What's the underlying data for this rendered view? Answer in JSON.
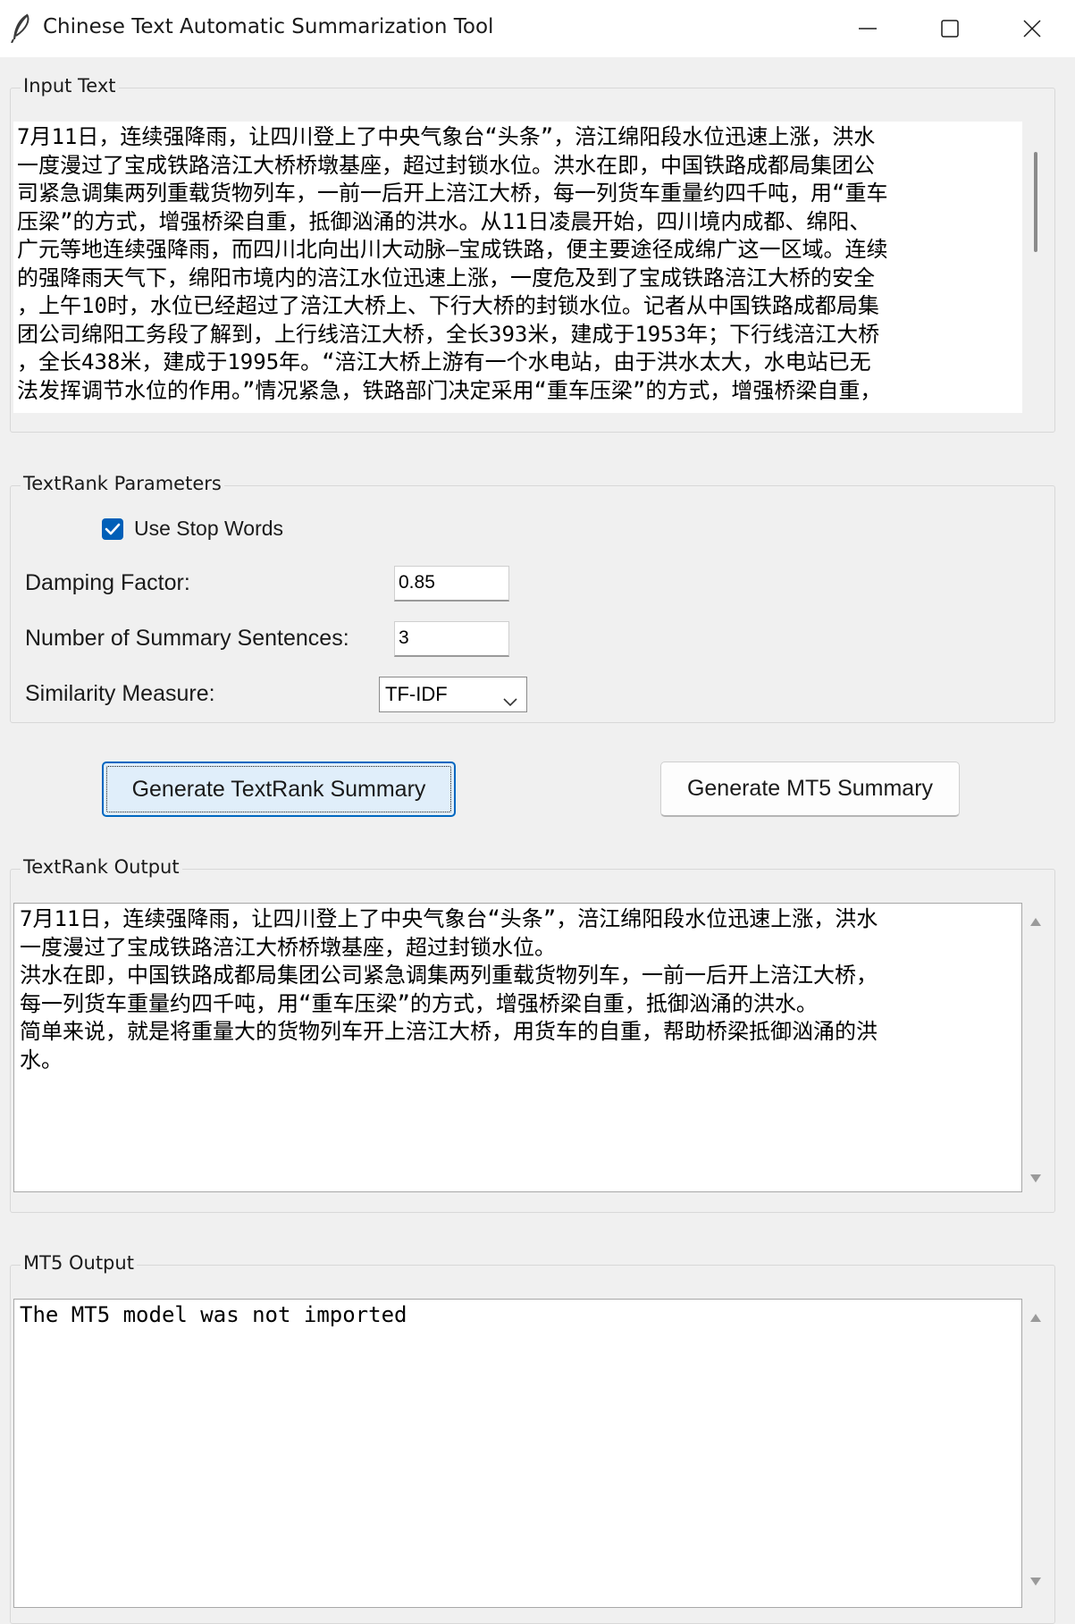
{
  "window": {
    "title": "Chinese Text Automatic Summarization Tool",
    "icons": {
      "app": "feather-icon",
      "minimize": "minimize-icon",
      "maximize": "maximize-icon",
      "close": "close-icon"
    }
  },
  "input_section": {
    "label": "Input Text",
    "lines": [
      "7月11日，连续强降雨，让四川登上了中央气象台“头条”，涪江绵阳段水位迅速上涨，洪水",
      "一度漫过了宝成铁路涪江大桥桥墩基座，超过封锁水位。洪水在即，中国铁路成都局集团公",
      "司紧急调集两列重载货物列车，一前一后开上涪江大桥，每一列货车重量约四千吨，用“重车",
      "压梁”的方式，增强桥梁自重，抵御汹涌的洪水。从11日凌晨开始，四川境内成都、绵阳、",
      "广元等地连续强降雨，而四川北向出川大动脉—宝成铁路，便主要途径成绵广这一区域。连续",
      "的强降雨天气下，绵阳市境内的涪江水位迅速上涨，一度危及到了宝成铁路涪江大桥的安全",
      "，上午10时，水位已经超过了涪江大桥上、下行大桥的封锁水位。记者从中国铁路成都局集",
      "团公司绵阳工务段了解到，上行线涪江大桥，全长393米，建成于1953年；下行线涪江大桥",
      "，全长438米，建成于1995年。“涪江大桥上游有一个水电站，由于洪水太大，水电站已无",
      "法发挥调节水位的作用。”情况紧急，铁路部门决定采用“重车压梁”的方式，增强桥梁自重，"
    ]
  },
  "params": {
    "label": "TextRank Parameters",
    "use_stop_words": {
      "label": "Use Stop Words",
      "checked": true
    },
    "damping": {
      "label": "Damping Factor:",
      "value": "0.85"
    },
    "num_sentences": {
      "label": "Number of Summary Sentences:",
      "value": "3"
    },
    "similarity": {
      "label": "Similarity Measure:",
      "value": "TF-IDF"
    }
  },
  "buttons": {
    "textrank": "Generate TextRank Summary",
    "mt5": "Generate MT5 Summary"
  },
  "textrank_output": {
    "label": "TextRank Output",
    "lines": [
      "7月11日，连续强降雨，让四川登上了中央气象台“头条”，涪江绵阳段水位迅速上涨，洪水",
      "一度漫过了宝成铁路涪江大桥桥墩基座，超过封锁水位。",
      "洪水在即，中国铁路成都局集团公司紧急调集两列重载货物列车，一前一后开上涪江大桥，",
      "每一列货车重量约四千吨，用“重车压梁”的方式，增强桥梁自重，抵御汹涌的洪水。",
      "简单来说，就是将重量大的货物列车开上涪江大桥，用货车的自重，帮助桥梁抵御汹涌的洪",
      "水。"
    ]
  },
  "mt5_output": {
    "label": "MT5 Output",
    "lines": [
      "The MT5 model was not imported"
    ]
  }
}
